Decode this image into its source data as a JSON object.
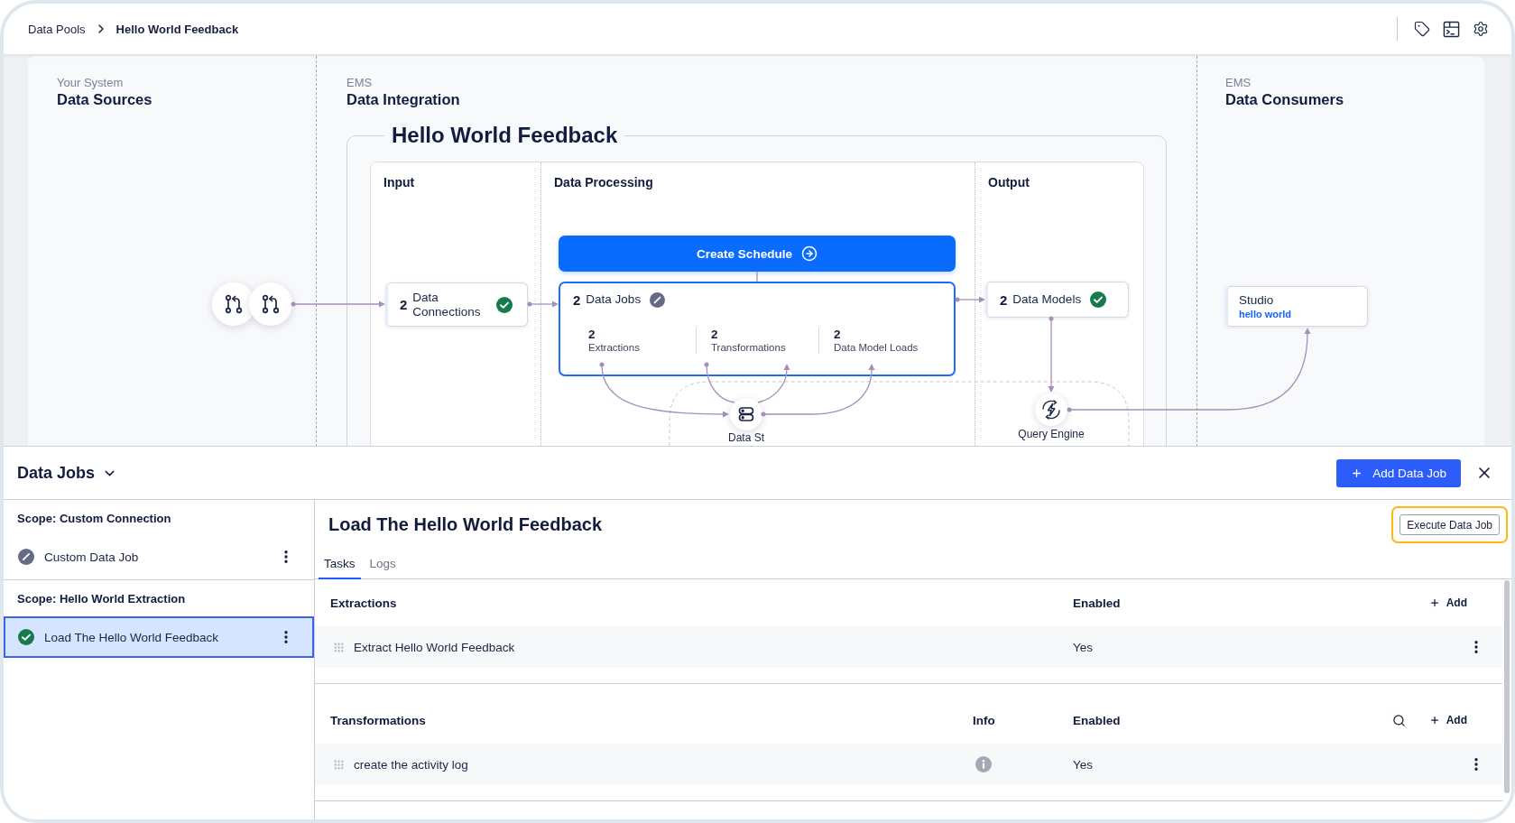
{
  "breadcrumb": [
    {
      "label": "Data Pools",
      "current": false
    },
    {
      "label": "Hello World Feedback",
      "current": true
    }
  ],
  "diagram": {
    "columns": [
      {
        "overline": "Your System",
        "title": "Data Sources"
      },
      {
        "overline": "EMS",
        "title": "Data Integration"
      },
      {
        "overline": "EMS",
        "title": "Data Consumers"
      }
    ],
    "pool": {
      "title": "Hello World Feedback",
      "stages": [
        "Input",
        "Data Processing",
        "Output"
      ]
    },
    "create_schedule": "Create Schedule",
    "data_connections": {
      "count": "2",
      "label": "Data Connections",
      "succeeded": true
    },
    "data_jobs": {
      "count": "2",
      "label": "Data Jobs",
      "succeeded": false,
      "stats": [
        {
          "count": "2",
          "label": "Extractions"
        },
        {
          "count": "2",
          "label": "Transformations"
        },
        {
          "count": "2",
          "label": "Data Model Loads"
        }
      ]
    },
    "data_models": {
      "count": "2",
      "label": "Data Models",
      "succeeded": true
    },
    "data_store": {
      "label": "Data St"
    },
    "query_engine": {
      "label": "Query Engine"
    },
    "consumer": {
      "title": "Studio",
      "subtitle": "hello world"
    }
  },
  "drawer": {
    "title": "Data Jobs",
    "add_button": "Add Data Job",
    "scopes": [
      {
        "title": "Scope: Custom Connection",
        "jobs": [
          {
            "name": "Custom Data Job",
            "succeeded": false,
            "selected": false
          }
        ]
      },
      {
        "title": "Scope: Hello World Extraction",
        "jobs": [
          {
            "name": "Load The Hello World Feedback",
            "succeeded": true,
            "selected": true
          }
        ]
      }
    ],
    "detail": {
      "title": "Load The Hello World Feedback",
      "execute": {
        "label": "Execute Data Job",
        "focused": true
      },
      "tabs": [
        {
          "label": "Tasks",
          "selected": true
        },
        {
          "label": "Logs",
          "selected": false
        }
      ],
      "sections": [
        {
          "title": "Extractions",
          "columns": [
            {
              "kind": "enabled",
              "label": "Enabled"
            }
          ],
          "searchable": false,
          "add_label": "Add",
          "rows": [
            {
              "name": "Extract Hello World Feedback",
              "enabled": "Yes"
            }
          ]
        },
        {
          "title": "Transformations",
          "columns": [
            {
              "kind": "info",
              "label": "Info"
            },
            {
              "kind": "enabled",
              "label": "Enabled"
            }
          ],
          "searchable": true,
          "add_label": "Add",
          "rows": [
            {
              "name": "create the activity log",
              "enabled": "Yes"
            }
          ]
        }
      ]
    }
  }
}
